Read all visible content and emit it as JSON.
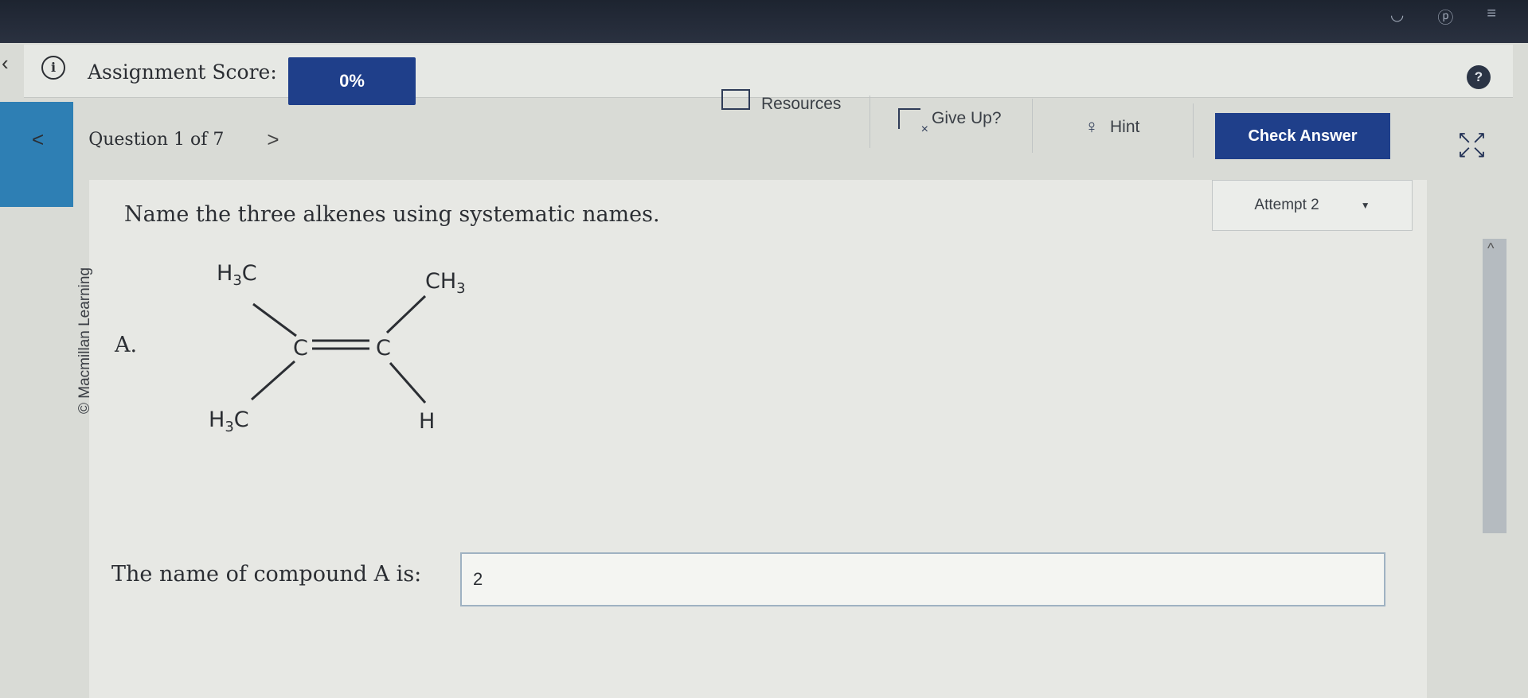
{
  "header": {
    "assignment_score_label": "Assignment Score:",
    "assignment_score_value": "0%",
    "resources_label": "Resources",
    "give_up_label": "Give Up?",
    "hint_label": "Hint",
    "check_answer_label": "Check Answer",
    "help_symbol": "?"
  },
  "nav": {
    "question_label": "Question 1 of 7",
    "prev_symbol": "<",
    "next_symbol": ">"
  },
  "attempt": {
    "label": "Attempt 2"
  },
  "content": {
    "credit": "© Macmillan Learning",
    "question_text": "Name the three alkenes using systematic names.",
    "compound_label": "A.",
    "molecule": {
      "top_left": "H3C",
      "bottom_left": "H3C",
      "top_right": "CH3",
      "bottom_right": "H",
      "carbon_left": "C",
      "carbon_right": "C"
    },
    "answer_label": "The name of compound A is:",
    "answer_value": "2"
  },
  "colors": {
    "brand_blue": "#1f3f8a",
    "accent_blue": "#2e7fb4"
  }
}
